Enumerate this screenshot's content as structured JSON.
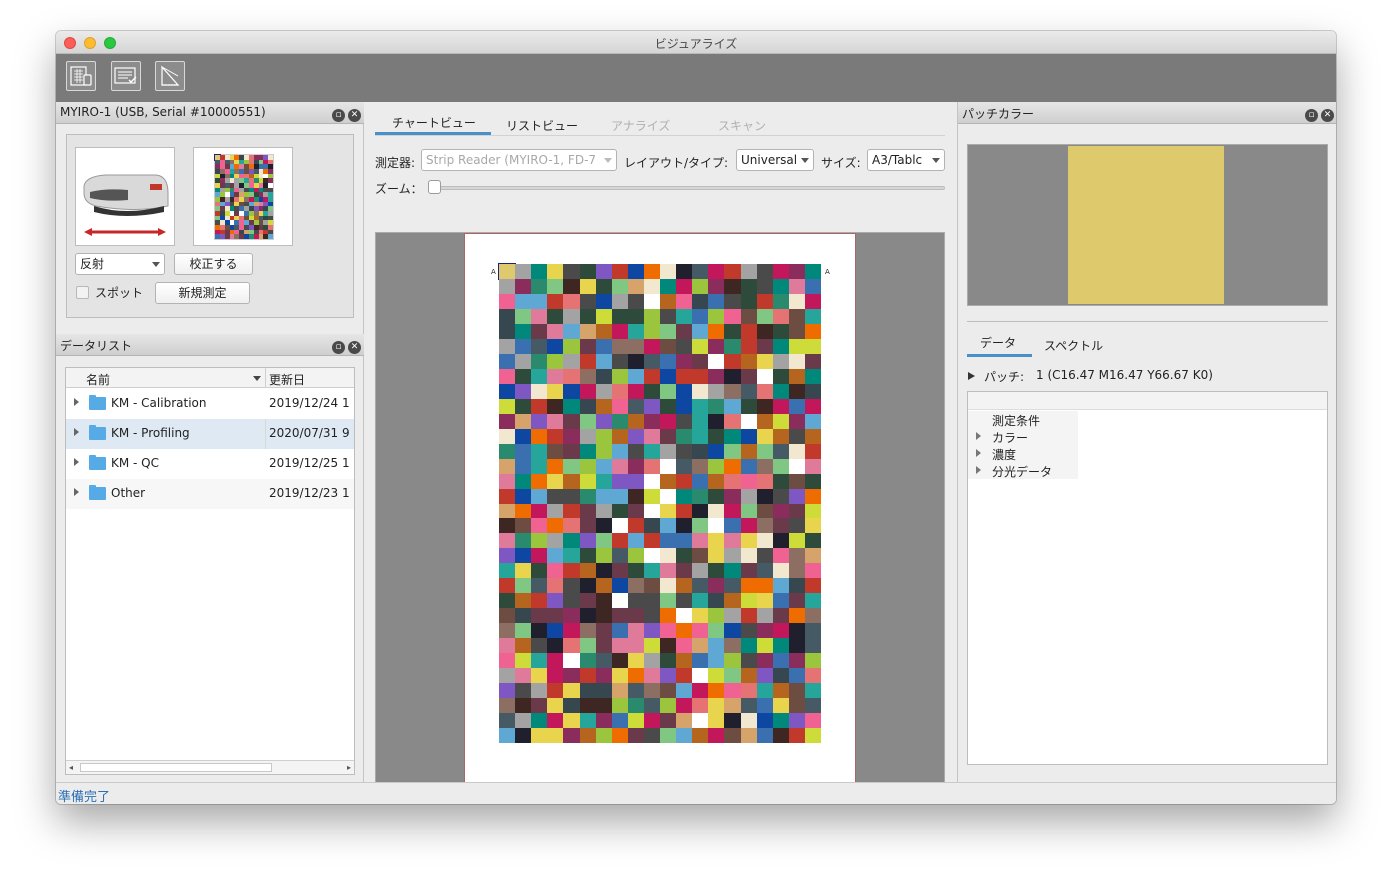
{
  "window": {
    "title": "ビジュアライズ"
  },
  "toolbar": {
    "buttons": [
      {
        "icon": "measure-chart-icon"
      },
      {
        "icon": "list-check-icon"
      },
      {
        "icon": "triangle-chart-icon"
      }
    ]
  },
  "device_panel": {
    "title": "MYIRO-1 (USB, Serial #10000551)",
    "mode_select": "反射",
    "calibrate_button": "校正する",
    "spot_checkbox": "スポット",
    "new_measure_button": "新規測定"
  },
  "data_list": {
    "title": "データリスト",
    "columns": {
      "name": "名前",
      "updated": "更新日"
    },
    "items": [
      {
        "name": "KM - Calibration",
        "date": "2019/12/24 1"
      },
      {
        "name": "KM - Profiling",
        "date": "2020/07/31 9"
      },
      {
        "name": "KM - QC",
        "date": "2019/12/25 1"
      },
      {
        "name": "Other",
        "date": "2019/12/23 1"
      }
    ]
  },
  "center": {
    "tabs": [
      {
        "label": "チャートビュー",
        "active": true
      },
      {
        "label": "リストビュー",
        "active": false
      },
      {
        "label": "アナライズ",
        "active": false,
        "disabled": true
      },
      {
        "label": "スキャン",
        "active": false,
        "disabled": true
      }
    ],
    "instrument_label": "測定器:",
    "instrument_value": "Strip Reader (MYIRO-1, FD-7",
    "layout_label": "レイアウト/タイプ:",
    "layout_value": "Universal",
    "size_label": "サイズ:",
    "size_value": "A3/Tablc",
    "zoom_label": "ズーム：",
    "zoom_value": 0,
    "chart_row_marker": "A"
  },
  "patch_panel": {
    "title": "パッチカラー",
    "patch_color": "#dec96d",
    "tabs": [
      {
        "label": "データ",
        "active": true
      },
      {
        "label": "スペクトル",
        "active": false
      }
    ],
    "patch_label": "パッチ:",
    "patch_value": "1 (C16.47 M16.47 Y66.67 K0)",
    "tree": [
      {
        "label": "測定条件",
        "expandable": false
      },
      {
        "label": "カラー",
        "expandable": true
      },
      {
        "label": "濃度",
        "expandable": true
      },
      {
        "label": "分光データ",
        "expandable": true
      }
    ]
  },
  "status": {
    "text": "準備完了"
  },
  "colors": {
    "accent": "#4a90c8",
    "status": "#2b6fb5"
  }
}
